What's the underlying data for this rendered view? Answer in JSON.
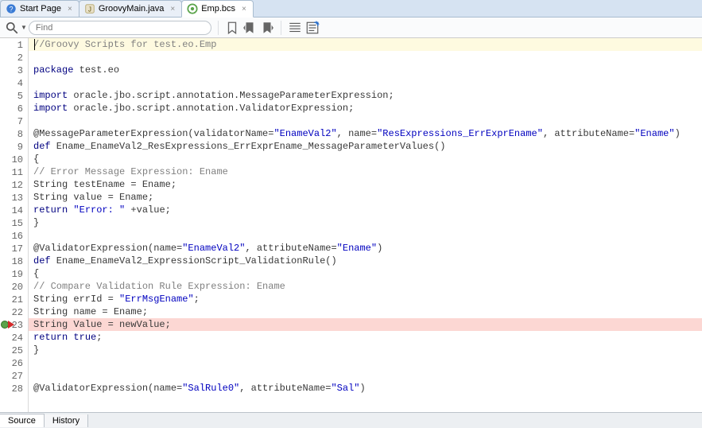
{
  "tabs": [
    {
      "label": "Start Page",
      "icon": "help"
    },
    {
      "label": "GroovyMain.java",
      "icon": "java"
    },
    {
      "label": "Emp.bcs",
      "icon": "groovy",
      "active": true
    }
  ],
  "toolbar": {
    "find_placeholder": "Find"
  },
  "code": {
    "lines": [
      {
        "n": 1,
        "hl": "yellow",
        "tokens": [
          [
            "cmt",
            "//Groovy Scripts for test.eo.Emp"
          ]
        ]
      },
      {
        "n": 2,
        "tokens": []
      },
      {
        "n": 3,
        "tokens": [
          [
            "kw",
            "package"
          ],
          [
            "plain",
            " test.eo"
          ]
        ]
      },
      {
        "n": 4,
        "tokens": []
      },
      {
        "n": 5,
        "tokens": [
          [
            "kw",
            "import"
          ],
          [
            "plain",
            " oracle.jbo.script.annotation.MessageParameterExpression;"
          ]
        ]
      },
      {
        "n": 6,
        "tokens": [
          [
            "kw",
            "import"
          ],
          [
            "plain",
            " oracle.jbo.script.annotation.ValidatorExpression;"
          ]
        ]
      },
      {
        "n": 7,
        "tokens": []
      },
      {
        "n": 8,
        "tokens": [
          [
            "plain",
            "@MessageParameterExpression(validatorName="
          ],
          [
            "str",
            "\"EnameVal2\""
          ],
          [
            "plain",
            ", name="
          ],
          [
            "str",
            "\"ResExpressions_ErrExprEname\""
          ],
          [
            "plain",
            ", attributeName="
          ],
          [
            "str",
            "\"Ename\""
          ],
          [
            "plain",
            ")"
          ]
        ]
      },
      {
        "n": 9,
        "tokens": [
          [
            "kw",
            "def"
          ],
          [
            "plain",
            " Ename_EnameVal2_ResExpressions_ErrExprEname_MessageParameterValues()"
          ]
        ]
      },
      {
        "n": 10,
        "tokens": [
          [
            "plain",
            "{"
          ]
        ]
      },
      {
        "n": 11,
        "tokens": [
          [
            "cmt",
            "// Error Message Expression: Ename"
          ]
        ]
      },
      {
        "n": 12,
        "tokens": [
          [
            "plain",
            "String testEname = Ename;"
          ]
        ]
      },
      {
        "n": 13,
        "tokens": [
          [
            "plain",
            "String value = Ename;"
          ]
        ]
      },
      {
        "n": 14,
        "tokens": [
          [
            "kw",
            "return"
          ],
          [
            "plain",
            " "
          ],
          [
            "str",
            "\"Error: \""
          ],
          [
            "plain",
            " +value;"
          ]
        ]
      },
      {
        "n": 15,
        "tokens": [
          [
            "plain",
            "}"
          ]
        ]
      },
      {
        "n": 16,
        "tokens": []
      },
      {
        "n": 17,
        "tokens": [
          [
            "plain",
            "@ValidatorExpression(name="
          ],
          [
            "str",
            "\"EnameVal2\""
          ],
          [
            "plain",
            ", attributeName="
          ],
          [
            "str",
            "\"Ename\""
          ],
          [
            "plain",
            ")"
          ]
        ]
      },
      {
        "n": 18,
        "tokens": [
          [
            "kw",
            "def"
          ],
          [
            "plain",
            " Ename_EnameVal2_ExpressionScript_ValidationRule()"
          ]
        ]
      },
      {
        "n": 19,
        "tokens": [
          [
            "plain",
            "{"
          ]
        ]
      },
      {
        "n": 20,
        "tokens": [
          [
            "cmt",
            "// Compare Validation Rule Expression: Ename"
          ]
        ]
      },
      {
        "n": 21,
        "tokens": [
          [
            "plain",
            "String errId = "
          ],
          [
            "str",
            "\"ErrMsgEname\""
          ],
          [
            "plain",
            ";"
          ]
        ]
      },
      {
        "n": 22,
        "tokens": [
          [
            "plain",
            "String name = Ename;"
          ]
        ]
      },
      {
        "n": 23,
        "hl": "red",
        "bp": true,
        "arrow": true,
        "tokens": [
          [
            "plain",
            "String Value = newValue;"
          ]
        ]
      },
      {
        "n": 24,
        "tokens": [
          [
            "kw",
            "return"
          ],
          [
            "plain",
            " "
          ],
          [
            "kw",
            "true"
          ],
          [
            "plain",
            ";"
          ]
        ]
      },
      {
        "n": 25,
        "tokens": [
          [
            "plain",
            "}"
          ]
        ]
      },
      {
        "n": 26,
        "tokens": []
      },
      {
        "n": 27,
        "tokens": []
      },
      {
        "n": 28,
        "tokens": [
          [
            "plain",
            "@ValidatorExpression(name="
          ],
          [
            "str",
            "\"SalRule0\""
          ],
          [
            "plain",
            ", attributeName="
          ],
          [
            "str",
            "\"Sal\""
          ],
          [
            "plain",
            ")"
          ]
        ]
      }
    ]
  },
  "bottom_tabs": [
    {
      "label": "Source",
      "active": true
    },
    {
      "label": "History"
    }
  ]
}
